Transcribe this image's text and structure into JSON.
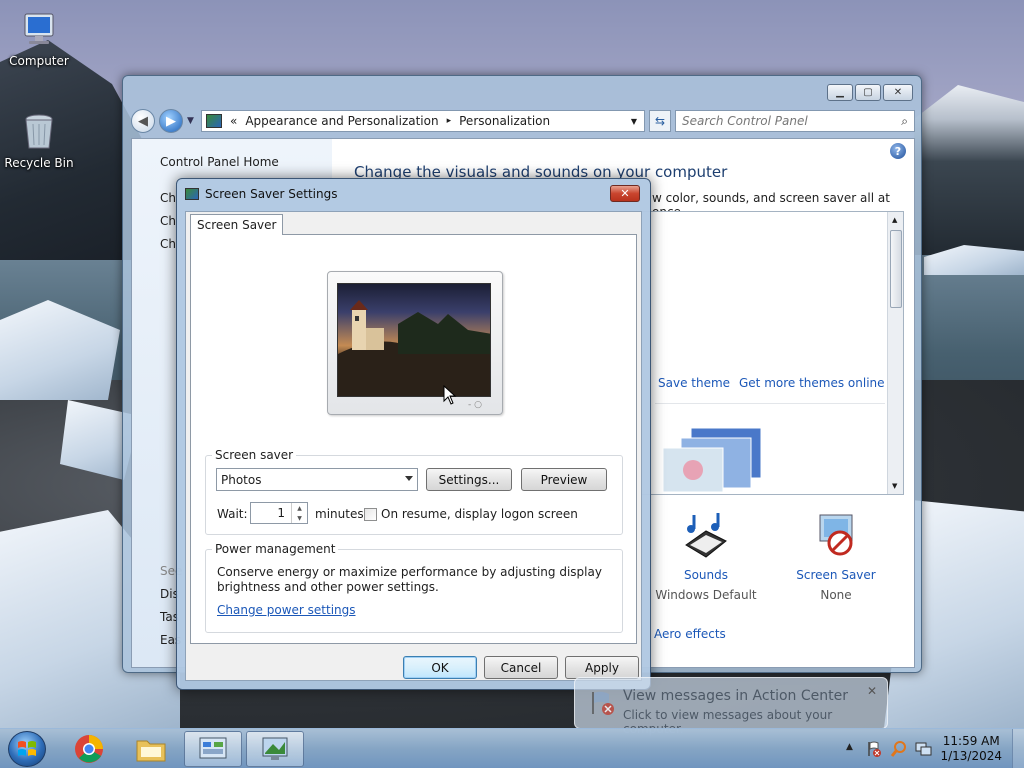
{
  "desktop": {
    "icons": [
      {
        "label": "Computer"
      },
      {
        "label": "Recycle Bin"
      }
    ]
  },
  "control_panel": {
    "breadcrumb_prefix": "«",
    "breadcrumb": [
      "Appearance and Personalization",
      "Personalization"
    ],
    "breadcrumb_separator": "▸",
    "search_placeholder": "Search Control Panel",
    "left_nav": {
      "home": "Control Panel Home",
      "partial_items": [
        "Ch",
        "Ch",
        "Ch"
      ],
      "see_also_partial": "See",
      "bottom_partial": [
        "Dis",
        "Tas",
        "Eas"
      ]
    },
    "title": "Change the visuals and sounds on your computer",
    "subtitle_partial": "w color, sounds, and screen saver all at once.",
    "links": {
      "save_theme": "Save theme",
      "get_more_themes": "Get more themes online",
      "aero_effects": "Aero effects"
    },
    "sounds": {
      "name": "Sounds",
      "value": "Windows Default"
    },
    "screen_saver": {
      "name": "Screen Saver",
      "value": "None"
    }
  },
  "dialog": {
    "title": "Screen Saver Settings",
    "tab": "Screen Saver",
    "screen_saver_group": "Screen saver",
    "selected_saver": "Photos",
    "settings_button": "Settings...",
    "preview_button": "Preview",
    "wait_label": "Wait:",
    "wait_value": "1",
    "minutes_label": "minutes",
    "logon_checkbox_label": "On resume, display logon screen",
    "logon_checkbox_checked": false,
    "power_group": "Power management",
    "power_text_line1": "Conserve energy or maximize performance by adjusting display",
    "power_text_line2": "brightness and other power settings.",
    "power_link": "Change power settings",
    "ok": "OK",
    "cancel": "Cancel",
    "apply": "Apply"
  },
  "notification": {
    "title": "View messages in Action Center",
    "body": "Click to view messages about your computer."
  },
  "taskbar": {
    "time": "11:59 AM",
    "date": "1/13/2024"
  },
  "colors": {
    "link": "#1c58b8",
    "title_blue": "#1e3f70",
    "close_red": "#c9452e"
  }
}
